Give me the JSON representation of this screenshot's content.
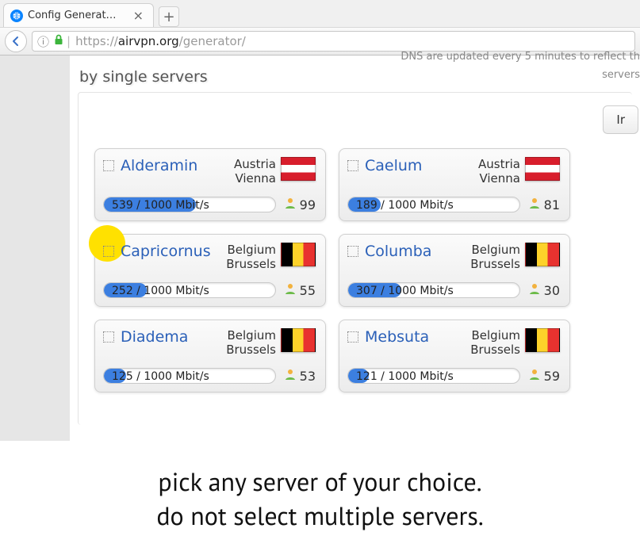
{
  "browser": {
    "tab_title": "Config Generat…",
    "url_prefix": "https://",
    "url_host_strong": "airvpn.org",
    "url_path": "/generator/"
  },
  "page": {
    "section_title": "by single servers",
    "banner_remnant_top": "DNS are updated every 5 minutes to reflect th",
    "banner_remnant_side": "servers",
    "invert_label": "Ir"
  },
  "servers": [
    {
      "name": "Alderamin",
      "country": "Austria",
      "city": "Vienna",
      "flag": "austria",
      "used": 539,
      "cap": 1000,
      "unit": "Mbit/s",
      "users": 99,
      "highlight": false
    },
    {
      "name": "Caelum",
      "country": "Austria",
      "city": "Vienna",
      "flag": "austria",
      "used": 189,
      "cap": 1000,
      "unit": "Mbit/s",
      "users": 81,
      "highlight": false
    },
    {
      "name": "Capricornus",
      "country": "Belgium",
      "city": "Brussels",
      "flag": "belgium",
      "used": 252,
      "cap": 1000,
      "unit": "Mbit/s",
      "users": 55,
      "highlight": true
    },
    {
      "name": "Columba",
      "country": "Belgium",
      "city": "Brussels",
      "flag": "belgium",
      "used": 307,
      "cap": 1000,
      "unit": "Mbit/s",
      "users": 30,
      "highlight": false
    },
    {
      "name": "Diadema",
      "country": "Belgium",
      "city": "Brussels",
      "flag": "belgium",
      "used": 125,
      "cap": 1000,
      "unit": "Mbit/s",
      "users": 53,
      "highlight": false
    },
    {
      "name": "Mebsuta",
      "country": "Belgium",
      "city": "Brussels",
      "flag": "belgium",
      "used": 121,
      "cap": 1000,
      "unit": "Mbit/s",
      "users": 59,
      "highlight": false
    }
  ],
  "annotation": {
    "line1": "pick any server of your choice.",
    "line2": "do not select multiple servers."
  }
}
